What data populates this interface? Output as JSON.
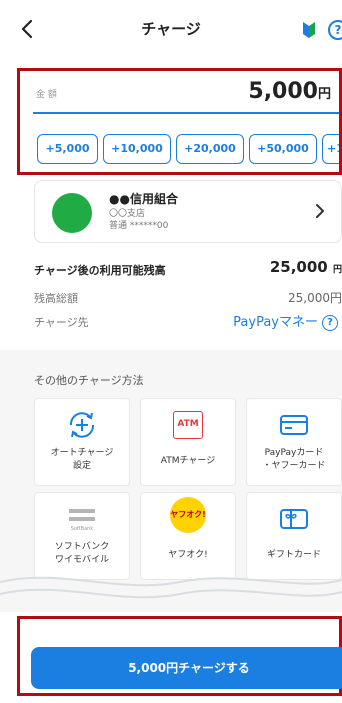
{
  "header": {
    "title": "チャージ",
    "help_glyph": "?"
  },
  "amount": {
    "label": "金 額",
    "value": "5,000",
    "unit": "円",
    "quick_buttons": [
      "+5,000",
      "+10,000",
      "+20,000",
      "+50,000",
      "+1"
    ]
  },
  "bank": {
    "name": "●●信用組合",
    "branch": "〇〇支店",
    "account": "普通 ******00"
  },
  "summary": {
    "available_label": "チャージ後の利用可能残高",
    "available_value": "25,000",
    "available_unit": "円",
    "total_label": "残高総額",
    "total_value": "25,000円",
    "destination_label": "チャージ先",
    "destination_value": "PayPayマネー"
  },
  "other_methods": {
    "title": "その他のチャージ方法",
    "tiles": [
      {
        "label": "オートチャージ\n設定",
        "icon": "auto-charge-icon"
      },
      {
        "label": "ATMチャージ",
        "icon": "atm-icon",
        "icon_text": "ATM"
      },
      {
        "label": "PayPayカード\n・ヤフーカード",
        "icon": "card-icon"
      },
      {
        "label": "ソフトバンク\nワイモバイル",
        "icon": "softbank-icon",
        "icon_text": "SoftBank"
      },
      {
        "label": "ヤフオク!",
        "icon": "yafuoku-icon",
        "icon_text": "ヤフオク!"
      },
      {
        "label": "ギフトカード",
        "icon": "gift-card-icon"
      }
    ]
  },
  "footer": {
    "charge_button": "5,000円チャージする"
  },
  "colors": {
    "accent": "#1a7fe0",
    "highlight_border": "#b30b14",
    "bank_logo": "#21ab45",
    "atm_red": "#e53939",
    "yafuoku_yellow": "#ffd200"
  }
}
